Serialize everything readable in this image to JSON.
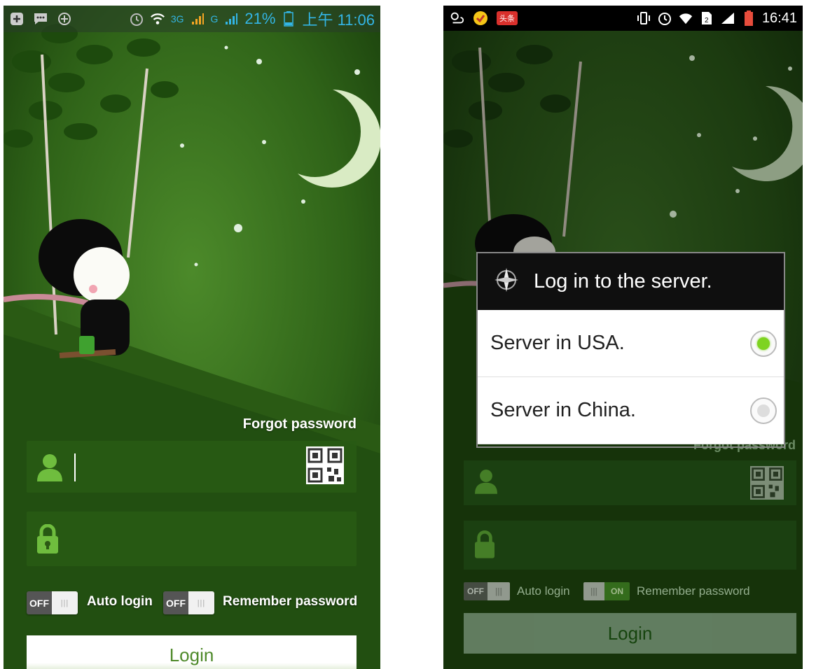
{
  "left_screen": {
    "status_bar": {
      "left_icons": [
        "plus-square-icon",
        "chat-bubble-icon",
        "add-circle-icon"
      ],
      "network_3g": "3G",
      "network_g": "G",
      "battery": "21%",
      "time": "上午 11:06"
    },
    "forgot_password": "Forgot password",
    "username_placeholder": "",
    "password_placeholder": "",
    "auto_login_toggle": "OFF",
    "auto_login_label": "Auto login",
    "remember_toggle": "OFF",
    "remember_label": "Remember password",
    "login_button": "Login"
  },
  "right_screen": {
    "status_bar": {
      "notification_badge": "头条",
      "time": "16:41"
    },
    "dialog": {
      "title": "Log in to the server.",
      "options": [
        {
          "label": "Server in USA.",
          "selected": true
        },
        {
          "label": "Server in China.",
          "selected": false
        }
      ]
    },
    "forgot_password": "Forgot password",
    "auto_login_toggle": "OFF",
    "auto_login_label": "Auto login",
    "remember_toggle": "ON",
    "remember_label": "Remember password",
    "login_button": "Login"
  },
  "colors": {
    "accent_blue": "#33b5e5",
    "field_green": "#2c5a14",
    "radio_selected": "#7ed321",
    "login_text_green": "#4f8a2b"
  }
}
